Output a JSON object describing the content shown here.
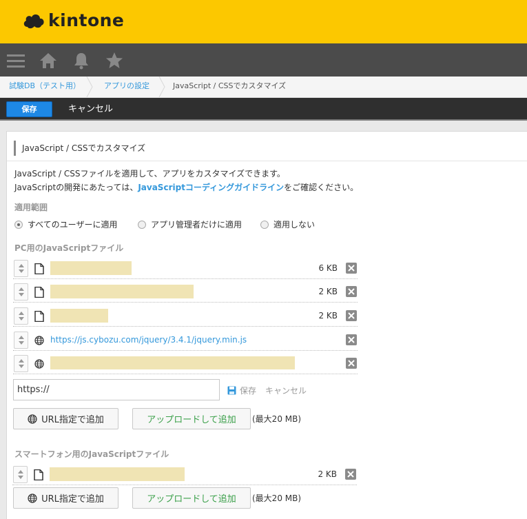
{
  "app": {
    "brand": "kintone",
    "brand_color": "#fcc800"
  },
  "nav": {
    "icons": [
      "menu-icon",
      "home-icon",
      "bell-icon",
      "star-icon"
    ]
  },
  "breadcrumb": {
    "items": [
      {
        "label": "試験DB（テスト用）"
      },
      {
        "label": "アプリの設定"
      },
      {
        "label": "JavaScript / CSSでカスタマイズ"
      }
    ]
  },
  "toolbar": {
    "save_label": "保存",
    "cancel_label": "キャンセル"
  },
  "panel": {
    "title": "JavaScript / CSSでカスタマイズ",
    "desc_line1": "JavaScript / CSSファイルを適用して、アプリをカスタマイズできます。",
    "desc_line2_prefix": "JavaScriptの開発にあたっては、",
    "desc_line2_link": "JavaScriptコーディングガイドライン",
    "desc_line2_suffix": "をご確認ください。",
    "scope": {
      "label": "適用範囲",
      "options": [
        {
          "label": "すべてのユーザーに適用",
          "selected": true
        },
        {
          "label": "アプリ管理者だけに適用",
          "selected": false
        },
        {
          "label": "適用しない",
          "selected": false
        }
      ]
    },
    "pc": {
      "label": "PC用のJavaScriptファイル",
      "files": [
        {
          "type": "file",
          "size": "6 KB"
        },
        {
          "type": "file",
          "size": "2 KB"
        },
        {
          "type": "file",
          "size": "2 KB"
        },
        {
          "type": "url",
          "url": "https://js.cybozu.com/jquery/3.4.1/jquery.min.js"
        },
        {
          "type": "url"
        }
      ],
      "url_input_value": "https://",
      "url_save": "保存",
      "url_cancel": "キャンセル",
      "add_url": "URL指定で追加",
      "upload": "アップロードして追加",
      "max": "(最大20 MB)"
    },
    "mobile": {
      "label": "スマートフォン用のJavaScriptファイル",
      "files": [
        {
          "type": "file",
          "size": "2 KB"
        }
      ],
      "add_url": "URL指定で追加",
      "upload": "アップロードして追加",
      "max": "(最大20 MB)"
    }
  }
}
